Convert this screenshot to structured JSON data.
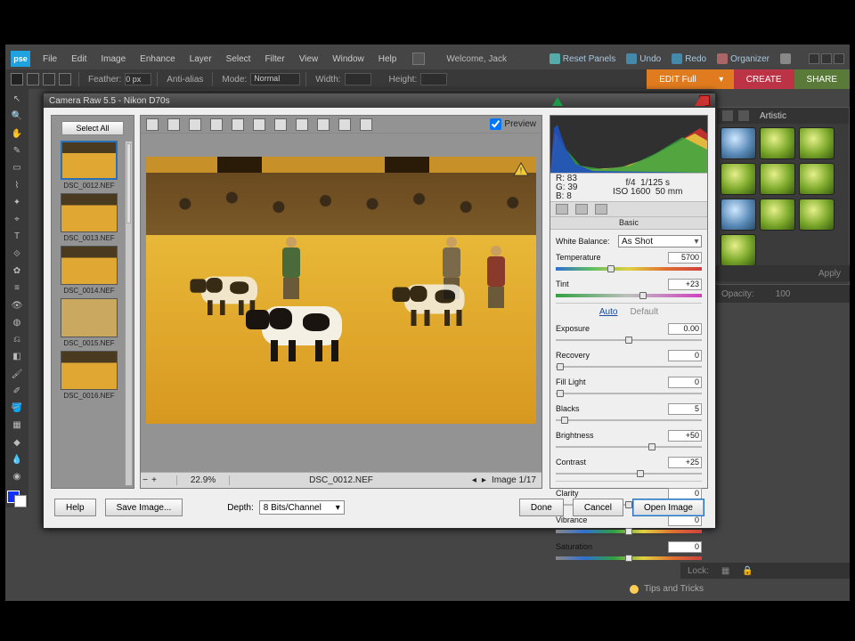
{
  "app": {
    "logo": "pse",
    "welcome": "Welcome, Jack"
  },
  "menu": {
    "file": "File",
    "edit": "Edit",
    "image": "Image",
    "enhance": "Enhance",
    "layer": "Layer",
    "select": "Select",
    "filter": "Filter",
    "view": "View",
    "window": "Window",
    "help": "Help"
  },
  "topRight": {
    "reset": "Reset Panels",
    "undo": "Undo",
    "redo": "Redo",
    "organizer": "Organizer"
  },
  "opt": {
    "feather_label": "Feather:",
    "feather_value": "0 px",
    "antialias": "Anti-alias",
    "mode_label": "Mode:",
    "mode_value": "Normal",
    "width_label": "Width:",
    "height_label": "Height:"
  },
  "bigButtons": {
    "edit": "EDIT Full",
    "create": "CREATE",
    "share": "SHARE"
  },
  "effects": {
    "title": "Artistic",
    "apply": "Apply",
    "opacity_label": "Opacity:",
    "opacity_value": "100",
    "lock_label": "Lock:"
  },
  "hint": {
    "text": "Tips and Tricks"
  },
  "dialog": {
    "title": "Camera Raw 5.5  -  Nikon D70s",
    "selectAll": "Select All",
    "thumbs": [
      "DSC_0012.NEF",
      "DSC_0013.NEF",
      "DSC_0014.NEF",
      "DSC_0015.NEF",
      "DSC_0016.NEF"
    ],
    "preview_label": "Preview",
    "zoom": "22.9%",
    "filename": "DSC_0012.NEF",
    "imgindex": "Image 1/17",
    "readout": {
      "R": "83",
      "G": "39",
      "B": "8",
      "f": "f/4",
      "shutter": "1/125 s",
      "iso": "ISO 1600",
      "lens": "50 mm"
    },
    "panel": "Basic",
    "wb_label": "White Balance:",
    "wb_value": "As Shot",
    "temp_label": "Temperature",
    "temp_value": "5700",
    "tint_label": "Tint",
    "tint_value": "+23",
    "auto": "Auto",
    "default": "Default",
    "exposure_label": "Exposure",
    "exposure_value": "0.00",
    "recovery_label": "Recovery",
    "recovery_value": "0",
    "fill_label": "Fill Light",
    "fill_value": "0",
    "blacks_label": "Blacks",
    "blacks_value": "5",
    "brightness_label": "Brightness",
    "brightness_value": "+50",
    "contrast_label": "Contrast",
    "contrast_value": "+25",
    "clarity_label": "Clarity",
    "clarity_value": "0",
    "vibrance_label": "Vibrance",
    "vibrance_value": "0",
    "saturation_label": "Saturation",
    "saturation_value": "0",
    "depth_label": "Depth:",
    "depth_value": "8 Bits/Channel",
    "btn_help": "Help",
    "btn_save": "Save Image...",
    "btn_done": "Done",
    "btn_cancel": "Cancel",
    "btn_open": "Open Image"
  },
  "sliderPos": {
    "temp": 38,
    "tint": 60,
    "exposure": 50,
    "recovery": 3,
    "fill": 3,
    "blacks": 6,
    "brightness": 66,
    "contrast": 58,
    "clarity": 50,
    "vibrance": 50,
    "saturation": 50
  }
}
